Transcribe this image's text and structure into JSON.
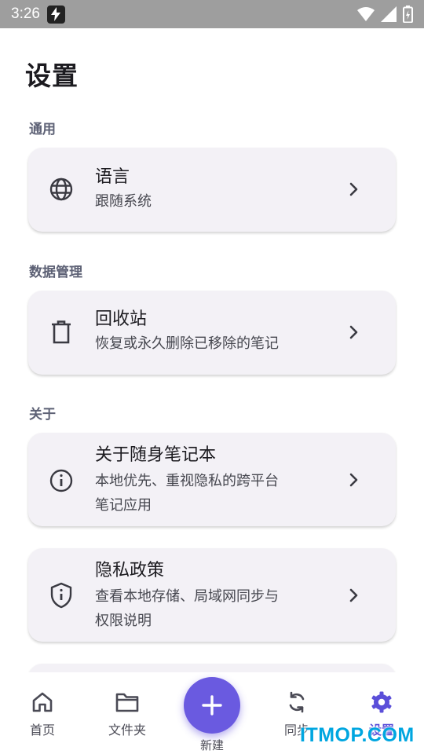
{
  "status_bar": {
    "time": "3:26"
  },
  "page": {
    "title": "设置"
  },
  "sections": {
    "general": {
      "label": "通用",
      "language": {
        "title": "语言",
        "subtitle": "跟随系统",
        "icon": "globe-icon"
      }
    },
    "data": {
      "label": "数据管理",
      "trash": {
        "title": "回收站",
        "subtitle": "恢复或永久删除已移除的笔记",
        "icon": "trash-icon"
      }
    },
    "about": {
      "label": "关于",
      "about_app": {
        "title": "关于随身笔记本",
        "subtitle_line1": "本地优先、重视隐私的跨平台",
        "subtitle_line2": "笔记应用",
        "icon": "info-icon"
      },
      "privacy": {
        "title": "隐私政策",
        "subtitle_line1": "查看本地存储、局域网同步与",
        "subtitle_line2": "权限说明",
        "icon": "shield-icon"
      }
    }
  },
  "bottom_nav": {
    "home": "首页",
    "folders": "文件夹",
    "new": "新建",
    "sync": "同步",
    "settings": "设置",
    "active": "settings"
  },
  "watermark": "ITMOP.COM",
  "colors": {
    "accent": "#6a5ae0",
    "card_bg": "#f3f1f6",
    "section_label": "#5d6175"
  }
}
